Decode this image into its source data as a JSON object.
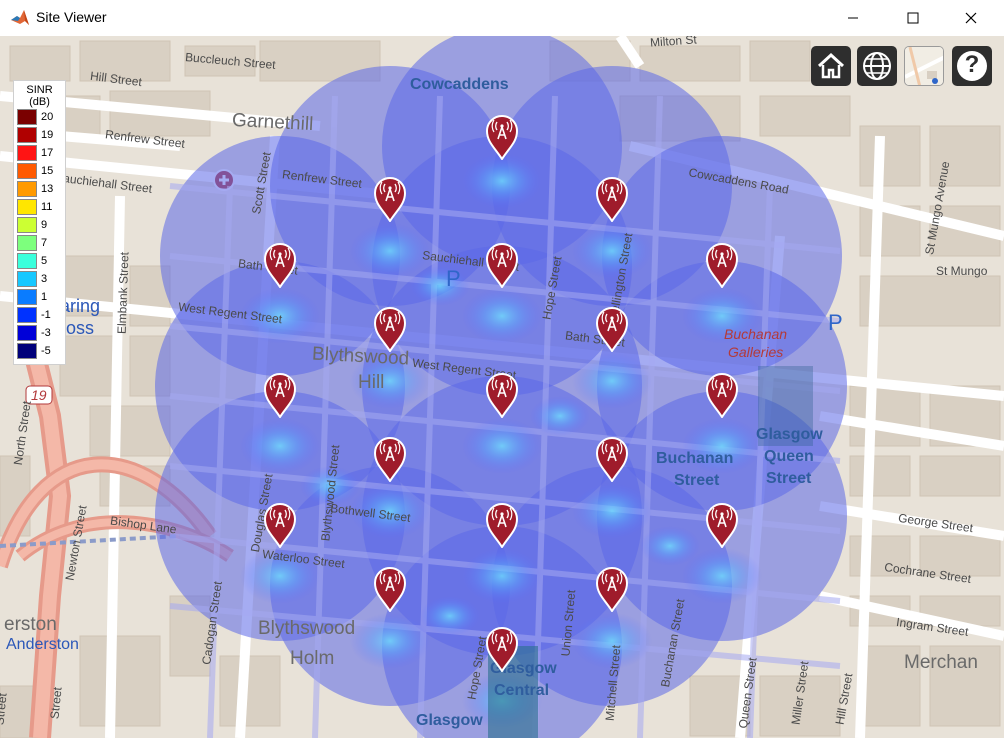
{
  "window": {
    "title": "Site Viewer"
  },
  "legend": {
    "title_line1": "SINR",
    "title_line2": "(dB)",
    "entries": [
      {
        "label": "20",
        "color": "#7a0000"
      },
      {
        "label": "19",
        "color": "#b00000"
      },
      {
        "label": "17",
        "color": "#ff1414"
      },
      {
        "label": "15",
        "color": "#ff5a00"
      },
      {
        "label": "13",
        "color": "#ff9a00"
      },
      {
        "label": "11",
        "color": "#ffe600"
      },
      {
        "label": "9",
        "color": "#ccff33"
      },
      {
        "label": "7",
        "color": "#7dff7d"
      },
      {
        "label": "5",
        "color": "#3affdc"
      },
      {
        "label": "3",
        "color": "#17c8ff"
      },
      {
        "label": "1",
        "color": "#0a7cff"
      },
      {
        "label": "-1",
        "color": "#0032ff"
      },
      {
        "label": "-3",
        "color": "#0000d8"
      },
      {
        "label": "-5",
        "color": "#00007a"
      }
    ]
  },
  "toolbar": {
    "home_icon": "home-icon",
    "globe_icon": "globe-icon",
    "basemap_icon": "basemap-picker-icon",
    "help_label": "?"
  },
  "map": {
    "districts": [
      "Garnethill",
      "Blythswood",
      "Hill",
      "Blythswood",
      "Holm",
      "Merchan",
      "erston",
      "Anderston",
      "aring",
      "ross"
    ],
    "streets": [
      "Buccleuch Street",
      "Hill Street",
      "Renfrew Street",
      "Sauchiehall Street",
      "Milton St",
      "Cowcaddens Road",
      "St Mungo Avenue",
      "St Mungo",
      "Scott Street",
      "Renfrew Street",
      "Bath Street",
      "West Regent Street",
      "Sauchiehall Street",
      "West Regent Street",
      "Bath Street",
      "Hope Street",
      "Wellington Street",
      "Elmbank Street",
      "North Street",
      "Newton Street",
      "Bishop Lane",
      "Douglas Street",
      "Blythswood Street",
      "Bothwell Street",
      "Waterloo Street",
      "Cadogan Street",
      "Hope Street",
      "Union Street",
      "Mitchell Street",
      "Buchanan Street",
      "George Street",
      "Cochrane Street",
      "Ingram Street",
      "Queen Street",
      "Miller Street",
      "Hill Street",
      "Street",
      "Street"
    ],
    "places": [
      "Cowcaddens",
      "Buchanan",
      "Galleries",
      "Glasgow",
      "Queen",
      "Street",
      "Buchanan",
      "Street",
      "Glasgow",
      "Central",
      "Glasgow"
    ],
    "parking": "P",
    "road_shield": "19",
    "transmitter_count": 20
  }
}
